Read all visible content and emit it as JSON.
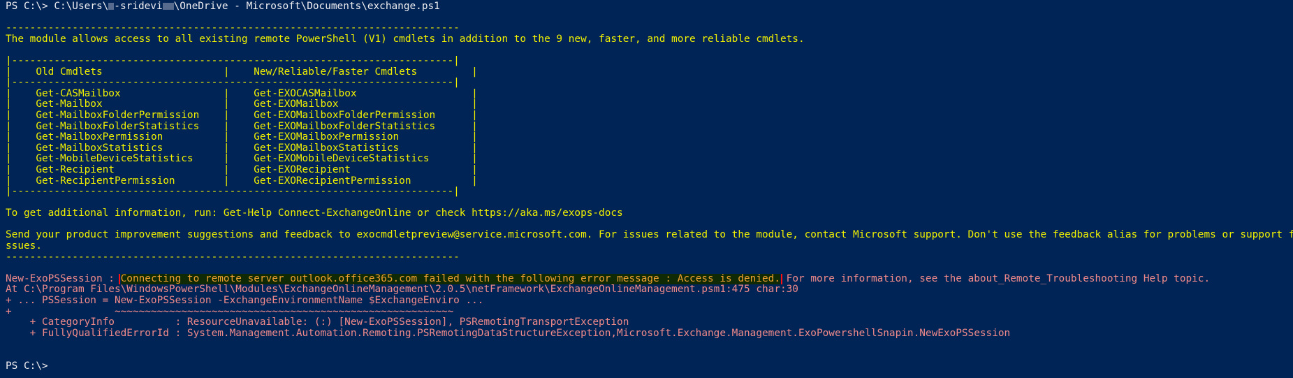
{
  "console": {
    "prompt": "PS C:\\>",
    "command_prefix": " C:\\Users\\",
    "command_mask_1": "x",
    "command_user": "-sridevi",
    "command_mask_2": "xx",
    "command_suffix": "\\OneDrive - Microsoft\\Documents\\exchange.ps1",
    "divider": "---------------------------------------------------------------------------",
    "module_intro": "The module allows access to all existing remote PowerShell (V1) cmdlets in addition to the 9 new, faster, and more reliable cmdlets.",
    "table": {
      "border": "|-------------------------------------------------------------------------|",
      "header_old": "Old Cmdlets",
      "header_new": "New/Reliable/Faster Cmdlets",
      "rows": [
        {
          "old": "Get-CASMailbox",
          "new": "Get-EXOCASMailbox"
        },
        {
          "old": "Get-Mailbox",
          "new": "Get-EXOMailbox"
        },
        {
          "old": "Get-MailboxFolderPermission",
          "new": "Get-EXOMailboxFolderPermission"
        },
        {
          "old": "Get-MailboxFolderStatistics",
          "new": "Get-EXOMailboxFolderStatistics"
        },
        {
          "old": "Get-MailboxPermission",
          "new": "Get-EXOMailboxPermission"
        },
        {
          "old": "Get-MailboxStatistics",
          "new": "Get-EXOMailboxStatistics"
        },
        {
          "old": "Get-MobileDeviceStatistics",
          "new": "Get-EXOMobileDeviceStatistics"
        },
        {
          "old": "Get-Recipient",
          "new": "Get-EXORecipient"
        },
        {
          "old": "Get-RecipientPermission",
          "new": "Get-EXORecipientPermission"
        }
      ]
    },
    "help_line": "To get additional information, run: Get-Help Connect-ExchangeOnline or check https://aka.ms/exops-docs",
    "feedback_line_1": "Send your product improvement suggestions and feedback to exocmdletpreview@service.microsoft.com. For issues related to the module, contact Microsoft support. Don't use the feedback alias for problems or support f",
    "feedback_line_2": "ssues.",
    "error": {
      "source": "New-ExoPSSession : ",
      "highlighted_message": "Connecting to remote server outlook.office365.com failed with the following error message : Access is denied.",
      "message_rest": " For more information, see the about_Remote_Troubleshooting Help topic.",
      "at_line": "At C:\\Program Files\\WindowsPowerShell\\Modules\\ExchangeOnlineManagement\\2.0.5\\netFramework\\ExchangeOnlineManagement.psm1:475 char:30",
      "code_line": "+ ... PSSession = New-ExoPSSession -ExchangeEnvironmentName $ExchangeEnviro ...",
      "tilde_line": "+                 ~~~~~~~~~~~~~~~~~~~~~~~~~~~~~~~~~~~~~~~~~~~~~~~~~~~~~~~~",
      "category_info": "    + CategoryInfo          : ResourceUnavailable: (:) [New-ExoPSSession], PSRemotingTransportException",
      "fully_qualified_error_id": "    + FullyQualifiedErrorId : System.Management.Automation.Remoting.PSRemotingDataStructureException,Microsoft.Exchange.Management.ExoPowershellSnapin.NewExoPSSession"
    },
    "final_prompt": "PS C:\\>"
  },
  "colors": {
    "background": "#012456",
    "info_text": "#f0f000",
    "error_text": "#f08a8a",
    "highlight_text": "#f0a030",
    "highlight_border": "#ff1010"
  }
}
